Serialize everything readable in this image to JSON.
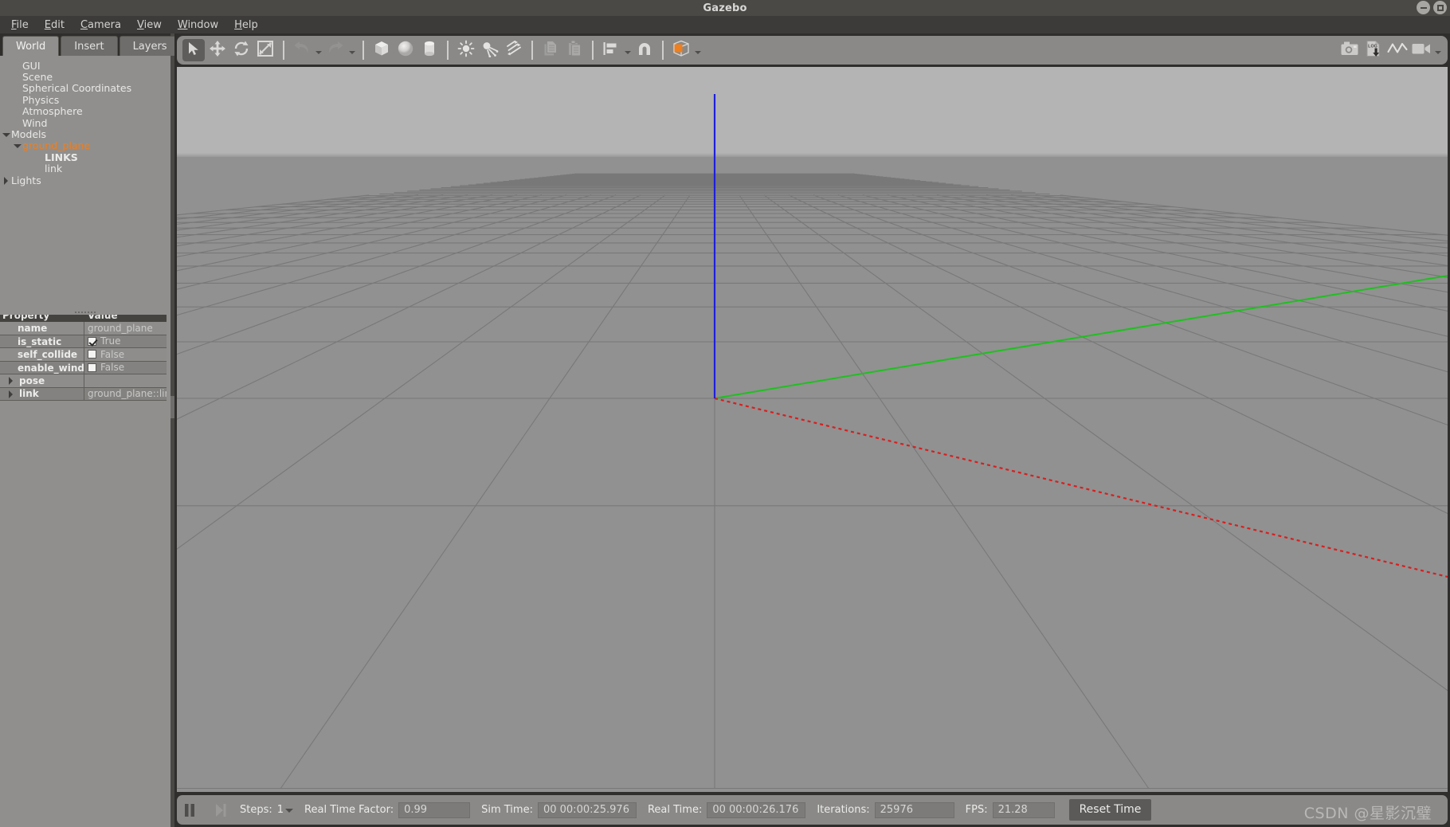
{
  "window": {
    "title": "Gazebo",
    "minimize_label": "minimize",
    "maximize_label": "maximize"
  },
  "menubar": {
    "items": [
      {
        "label": "File",
        "accel": "F"
      },
      {
        "label": "Edit",
        "accel": "E"
      },
      {
        "label": "Camera",
        "accel": "C"
      },
      {
        "label": "View",
        "accel": "V"
      },
      {
        "label": "Window",
        "accel": "W"
      },
      {
        "label": "Help",
        "accel": "H"
      }
    ]
  },
  "left_panel": {
    "tabs": [
      {
        "label": "World",
        "active": true
      },
      {
        "label": "Insert",
        "active": false
      },
      {
        "label": "Layers",
        "active": false
      }
    ],
    "tree": [
      {
        "label": "GUI",
        "indent": 1,
        "arrow": "none",
        "style": "normal"
      },
      {
        "label": "Scene",
        "indent": 1,
        "arrow": "none",
        "style": "normal"
      },
      {
        "label": "Spherical Coordinates",
        "indent": 1,
        "arrow": "none",
        "style": "normal"
      },
      {
        "label": "Physics",
        "indent": 1,
        "arrow": "none",
        "style": "normal"
      },
      {
        "label": "Atmosphere",
        "indent": 1,
        "arrow": "none",
        "style": "normal"
      },
      {
        "label": "Wind",
        "indent": 1,
        "arrow": "none",
        "style": "normal"
      },
      {
        "label": "Models",
        "indent": 0,
        "arrow": "down",
        "style": "normal"
      },
      {
        "label": "ground_plane",
        "indent": 1,
        "arrow": "down",
        "style": "orange"
      },
      {
        "label": "LINKS",
        "indent": 3,
        "arrow": "none",
        "style": "bold"
      },
      {
        "label": "link",
        "indent": 3,
        "arrow": "none",
        "style": "normal"
      },
      {
        "label": "Lights",
        "indent": 0,
        "arrow": "right",
        "style": "normal"
      }
    ],
    "property_table": {
      "headers": {
        "property": "Property",
        "value": "Value"
      },
      "rows": [
        {
          "name": "name",
          "value": "ground_plane",
          "type": "text",
          "checked": false,
          "expandable": false
        },
        {
          "name": "is_static",
          "value": "True",
          "type": "checkbox",
          "checked": true,
          "expandable": false
        },
        {
          "name": "self_collide",
          "value": "False",
          "type": "checkbox",
          "checked": false,
          "expandable": false
        },
        {
          "name": "enable_wind",
          "value": "False",
          "type": "checkbox",
          "checked": false,
          "expandable": false
        },
        {
          "name": "pose",
          "value": "",
          "type": "text",
          "checked": false,
          "expandable": true
        },
        {
          "name": "link",
          "value": "ground_plane::link",
          "type": "text",
          "checked": false,
          "expandable": true
        }
      ]
    }
  },
  "toolbar": {
    "left_tools": [
      {
        "name": "select-mode",
        "icon": "cursor-arrow-icon",
        "active": true,
        "caret": false,
        "disabled": false
      },
      {
        "name": "translate-mode",
        "icon": "move-arrows-icon",
        "active": false,
        "caret": false,
        "disabled": false
      },
      {
        "name": "rotate-mode",
        "icon": "rotate-icon",
        "active": false,
        "caret": false,
        "disabled": false
      },
      {
        "name": "scale-mode",
        "icon": "scale-icon",
        "active": false,
        "caret": false,
        "disabled": false
      },
      {
        "name": "separator-1",
        "icon": "separator",
        "active": false,
        "caret": false,
        "disabled": false
      },
      {
        "name": "undo",
        "icon": "undo-arrow-icon",
        "active": false,
        "caret": true,
        "disabled": true
      },
      {
        "name": "redo",
        "icon": "redo-arrow-icon",
        "active": false,
        "caret": true,
        "disabled": true
      },
      {
        "name": "separator-2",
        "icon": "separator",
        "active": false,
        "caret": false,
        "disabled": false
      },
      {
        "name": "insert-box",
        "icon": "box-icon",
        "active": false,
        "caret": false,
        "disabled": false
      },
      {
        "name": "insert-sphere",
        "icon": "sphere-icon",
        "active": false,
        "caret": false,
        "disabled": false
      },
      {
        "name": "insert-cylinder",
        "icon": "cylinder-icon",
        "active": false,
        "caret": false,
        "disabled": false
      },
      {
        "name": "separator-3",
        "icon": "separator",
        "active": false,
        "caret": false,
        "disabled": false
      },
      {
        "name": "point-light",
        "icon": "point-light-icon",
        "active": false,
        "caret": false,
        "disabled": false
      },
      {
        "name": "spot-light",
        "icon": "spot-light-icon",
        "active": false,
        "caret": false,
        "disabled": false
      },
      {
        "name": "directional-light",
        "icon": "directional-light-icon",
        "active": false,
        "caret": false,
        "disabled": false
      },
      {
        "name": "separator-4",
        "icon": "separator",
        "active": false,
        "caret": false,
        "disabled": false
      },
      {
        "name": "copy",
        "icon": "copy-icon",
        "active": false,
        "caret": false,
        "disabled": true
      },
      {
        "name": "paste",
        "icon": "paste-icon",
        "active": false,
        "caret": false,
        "disabled": true
      },
      {
        "name": "separator-5",
        "icon": "separator",
        "active": false,
        "caret": false,
        "disabled": false
      },
      {
        "name": "align",
        "icon": "align-icon",
        "active": false,
        "caret": true,
        "disabled": false
      },
      {
        "name": "snap",
        "icon": "magnet-snap-icon",
        "active": false,
        "caret": false,
        "disabled": false
      },
      {
        "name": "separator-6",
        "icon": "separator",
        "active": false,
        "caret": false,
        "disabled": false
      },
      {
        "name": "view-angle",
        "icon": "orange-cube-icon",
        "active": false,
        "caret": true,
        "disabled": false
      }
    ],
    "right_tools": [
      {
        "name": "screenshot",
        "icon": "camera-icon",
        "caret": false
      },
      {
        "name": "log-record",
        "icon": "log-download-icon",
        "caret": false
      },
      {
        "name": "plot-window",
        "icon": "plot-line-icon",
        "caret": false
      },
      {
        "name": "video-record",
        "icon": "video-camera-icon",
        "caret": true
      }
    ],
    "accent_color": "#ef7f1f"
  },
  "viewport": {
    "sky_color": "#b4b4b4",
    "ground_color": "#919191",
    "grid_color": "#787878",
    "axis_x_color": "#d92020",
    "axis_y_color": "#20c020",
    "axis_z_color": "#2020e0"
  },
  "statusbar": {
    "pause_label": "pause",
    "step_label": "step-forward",
    "steps_label": "Steps:",
    "steps_value": "1",
    "rtf_label": "Real Time Factor:",
    "rtf_value": "0.99",
    "sim_time_label": "Sim Time:",
    "sim_time_value": "00 00:00:25.976",
    "real_time_label": "Real Time:",
    "real_time_value": "00 00:00:26.176",
    "iterations_label": "Iterations:",
    "iterations_value": "25976",
    "fps_label": "FPS:",
    "fps_value": "21.28",
    "reset_time_label": "Reset Time"
  },
  "watermark": {
    "text": "CSDN @星影沉璧"
  }
}
